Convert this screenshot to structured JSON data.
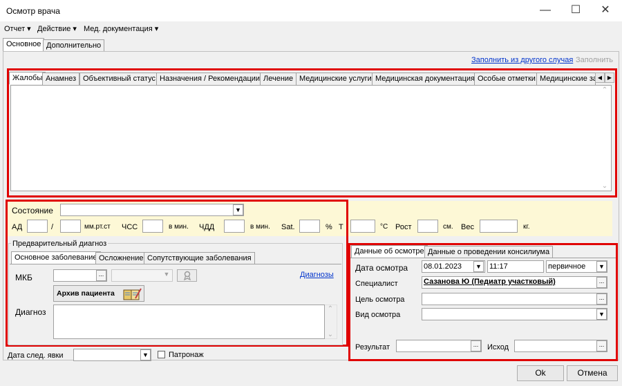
{
  "window": {
    "title": "Осмотр врача",
    "minimize_glyph": "—",
    "maximize_glyph": "☐",
    "close_glyph": "✕"
  },
  "menu": [
    "Отчет ▾",
    "Действие ▾",
    "Мед. документация ▾"
  ],
  "top_tabs": [
    "Основное",
    "Дополнительно"
  ],
  "fill_from_case_link": "Заполнить из другого случая",
  "fill_button": "Заполнить",
  "main_tabs": [
    "Жалобы",
    "Анамнез",
    "Объективный статус",
    "Назначения / Рекомендации",
    "Лечение",
    "Медицинские услуги",
    "Медицинская документация",
    "Особые отметки",
    "Медицинские за"
  ],
  "state": {
    "label": "Состояние",
    "ad_label": "АД",
    "slash": "/",
    "ad_unit": "мм.рт.ст",
    "hss_label": "ЧСС",
    "per_min": "в мин.",
    "chdd_label": "ЧДД",
    "per_min2": "в мин.",
    "sat_label": "Sat.",
    "pct": "%",
    "t_label": "Т",
    "t_unit": "°С",
    "height_label": "Рост",
    "height_unit": "см.",
    "weight_label": "Вес",
    "weight_unit": "кг."
  },
  "prelim": {
    "group_title": "Предварительный диагноз",
    "tabs": [
      "Основное заболевание",
      "Осложнение",
      "Сопутствующие заболевания"
    ],
    "mkb_label": "МКБ",
    "diagnoses_link": "Диагнозы",
    "archive_button": "Архив пациента",
    "diagnosis_label": "Диагноз"
  },
  "exam": {
    "tabs": [
      "Данные об осмотре",
      "Данные о проведении консилиума"
    ],
    "date_label": "Дата осмотра",
    "date_value": "08.01.2023",
    "time_value": "11:17",
    "type_value": "первичное",
    "specialist_label": "Специалист",
    "specialist_value": "Сазанова Ю (Педиатр участковый)",
    "purpose_label": "Цель осмотра",
    "kind_label": "Вид осмотра",
    "result_label": "Результат",
    "outcome_label": "Исход"
  },
  "next_visit_label": "Дата след. явки",
  "patronage_label": "Патронаж",
  "ok_button": "Ok",
  "cancel_button": "Отмена",
  "icons": {
    "dropdown": "▼",
    "ellipsis": "...",
    "tab_left": "◀",
    "tab_right": "▶",
    "scroll_up": "⌃",
    "scroll_down": "⌄"
  },
  "colors": {
    "highlight": "#e00000",
    "state_panel": "#fdf8d6",
    "link": "#0033cc"
  }
}
